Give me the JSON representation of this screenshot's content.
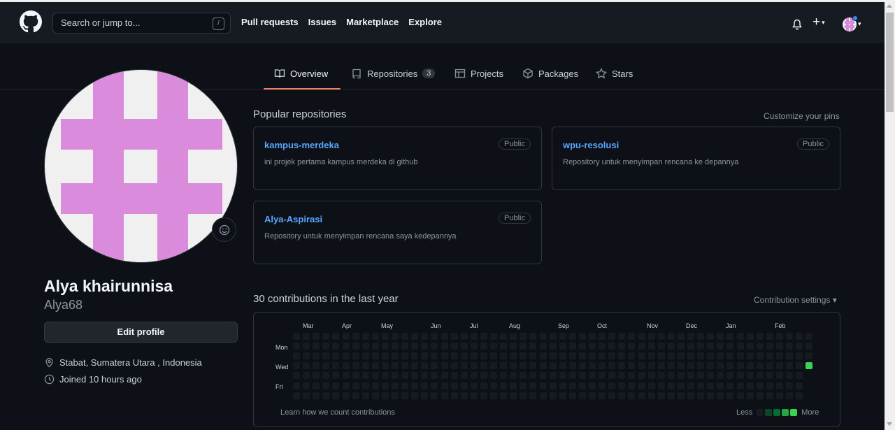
{
  "header": {
    "search_placeholder": "Search or jump to...",
    "search_key": "/",
    "nav": [
      "Pull requests",
      "Issues",
      "Marketplace",
      "Explore"
    ],
    "plus": "+"
  },
  "tabs": [
    {
      "label": "Overview",
      "active": true
    },
    {
      "label": "Repositories",
      "count": "3"
    },
    {
      "label": "Projects"
    },
    {
      "label": "Packages"
    },
    {
      "label": "Stars"
    }
  ],
  "profile": {
    "full_name": "Alya khairunnisa",
    "username": "Alya68",
    "edit_button": "Edit profile",
    "location": "Stabat, Sumatera Utara , Indonesia",
    "joined": "Joined 10 hours ago"
  },
  "popular": {
    "title": "Popular repositories",
    "customize": "Customize your pins",
    "repos": [
      {
        "name": "kampus-merdeka",
        "badge": "Public",
        "description": "ini projek pertama kampus merdeka di github"
      },
      {
        "name": "wpu-resolusi",
        "badge": "Public",
        "description": "Repository untuk menyimpan rencana ke depannya"
      },
      {
        "name": "Alya-Aspirasi",
        "badge": "Public",
        "description": "Repository untuk menyimpan rencana saya kedepannya"
      }
    ]
  },
  "contributions": {
    "title": "30 contributions in the last year",
    "settings": "Contribution settings",
    "months": [
      "Mar",
      "Apr",
      "May",
      "Jun",
      "Jul",
      "Aug",
      "Sep",
      "Oct",
      "Nov",
      "Dec",
      "Jan",
      "Feb"
    ],
    "days": [
      "Mon",
      "Wed",
      "Fri"
    ],
    "weeks": 53,
    "active_cells": [
      {
        "week": 52,
        "day": 3,
        "level": 4
      }
    ],
    "footer_link": "Learn how we count contributions",
    "legend_less": "Less",
    "legend_more": "More",
    "level_colors": [
      "#161b22",
      "#0e4429",
      "#006d32",
      "#26a641",
      "#39d353"
    ]
  }
}
